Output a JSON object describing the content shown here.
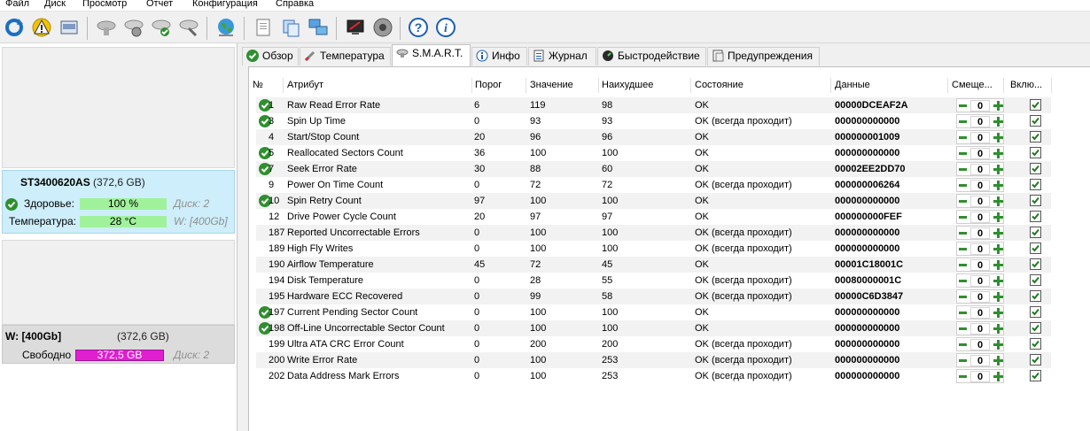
{
  "menu": [
    "Файл",
    "Диск",
    "Просмотр",
    "Отчет",
    "Конфигурация",
    "Справка"
  ],
  "toolbar": {
    "icons": [
      "refresh-icon",
      "warning-icon",
      "drive-icon",
      "disk-gray-icon",
      "disk-settings-icon",
      "disk-check-icon",
      "disk-tools-icon",
      "globe-icon",
      "document-icon",
      "copy-icon",
      "network-icon",
      "monitor-icon",
      "speaker-icon",
      "help-icon",
      "info-icon"
    ]
  },
  "left": {
    "disk": {
      "name": "ST3400620AS",
      "size": "(372,6 GB)",
      "health_label": "Здоровье:",
      "health_value": "100 %",
      "health_fill": 1.0,
      "disk_label": "Диск: 2",
      "temp_label": "Температура:",
      "temp_value": "28 °C",
      "temp_fill": 1.0,
      "volume_ref": "W: [400Gb]"
    },
    "volume": {
      "name": "W: [400Gb]",
      "size": "(372,6 GB)",
      "free_label": "Свободно",
      "free_value": "372,5 GB",
      "free_fill": 1.0,
      "disk_label": "Диск: 2"
    }
  },
  "tabs": [
    {
      "label": "Обзор",
      "icon": "overview-check-icon"
    },
    {
      "label": "Температура",
      "icon": "thermometer-icon"
    },
    {
      "label": "S.M.A.R.T.",
      "icon": "smart-disk-icon",
      "active": true
    },
    {
      "label": "Инфо",
      "icon": "info-icon"
    },
    {
      "label": "Журнал",
      "icon": "journal-icon"
    },
    {
      "label": "Быстродействие",
      "icon": "speedometer-icon"
    },
    {
      "label": "Предупреждения",
      "icon": "warnings-icon"
    }
  ],
  "table": {
    "headers": [
      "№",
      "Атрибут",
      "Порог",
      "Значение",
      "Наихудшее",
      "Состояние",
      "Данные",
      "Смеще...",
      "Вклю..."
    ],
    "rows": [
      {
        "ok": true,
        "id": "1",
        "name": "Raw Read Error Rate",
        "threshold": "6",
        "value": "119",
        "worst": "98",
        "status": "OK",
        "data": "00000DCEAF2A",
        "offset": "0",
        "enabled": true
      },
      {
        "ok": true,
        "id": "3",
        "name": "Spin Up Time",
        "threshold": "0",
        "value": "93",
        "worst": "93",
        "status": "OK (всегда проходит)",
        "data": "000000000000",
        "offset": "0",
        "enabled": true
      },
      {
        "ok": false,
        "id": "4",
        "name": "Start/Stop Count",
        "threshold": "20",
        "value": "96",
        "worst": "96",
        "status": "OK",
        "data": "000000001009",
        "offset": "0",
        "enabled": true
      },
      {
        "ok": true,
        "id": "5",
        "name": "Reallocated Sectors Count",
        "threshold": "36",
        "value": "100",
        "worst": "100",
        "status": "OK",
        "data": "000000000000",
        "offset": "0",
        "enabled": true
      },
      {
        "ok": true,
        "id": "7",
        "name": "Seek Error Rate",
        "threshold": "30",
        "value": "88",
        "worst": "60",
        "status": "OK",
        "data": "00002EE2DD70",
        "offset": "0",
        "enabled": true
      },
      {
        "ok": false,
        "id": "9",
        "name": "Power On Time Count",
        "threshold": "0",
        "value": "72",
        "worst": "72",
        "status": "OK (всегда проходит)",
        "data": "000000006264",
        "offset": "0",
        "enabled": true
      },
      {
        "ok": true,
        "id": "10",
        "name": "Spin Retry Count",
        "threshold": "97",
        "value": "100",
        "worst": "100",
        "status": "OK",
        "data": "000000000000",
        "offset": "0",
        "enabled": true
      },
      {
        "ok": false,
        "id": "12",
        "name": "Drive Power Cycle Count",
        "threshold": "20",
        "value": "97",
        "worst": "97",
        "status": "OK",
        "data": "000000000FEF",
        "offset": "0",
        "enabled": true
      },
      {
        "ok": false,
        "id": "187",
        "name": "Reported Uncorrectable Errors",
        "threshold": "0",
        "value": "100",
        "worst": "100",
        "status": "OK (всегда проходит)",
        "data": "000000000000",
        "offset": "0",
        "enabled": true
      },
      {
        "ok": false,
        "id": "189",
        "name": "High Fly Writes",
        "threshold": "0",
        "value": "100",
        "worst": "100",
        "status": "OK (всегда проходит)",
        "data": "000000000000",
        "offset": "0",
        "enabled": true
      },
      {
        "ok": false,
        "id": "190",
        "name": "Airflow Temperature",
        "threshold": "45",
        "value": "72",
        "worst": "45",
        "status": "OK",
        "data": "00001C18001C",
        "offset": "0",
        "enabled": true
      },
      {
        "ok": false,
        "id": "194",
        "name": "Disk Temperature",
        "threshold": "0",
        "value": "28",
        "worst": "55",
        "status": "OK (всегда проходит)",
        "data": "00080000001C",
        "offset": "0",
        "enabled": true
      },
      {
        "ok": false,
        "id": "195",
        "name": "Hardware ECC Recovered",
        "threshold": "0",
        "value": "99",
        "worst": "58",
        "status": "OK (всегда проходит)",
        "data": "00000C6D3847",
        "offset": "0",
        "enabled": true
      },
      {
        "ok": true,
        "id": "197",
        "name": "Current Pending Sector Count",
        "threshold": "0",
        "value": "100",
        "worst": "100",
        "status": "OK",
        "data": "000000000000",
        "offset": "0",
        "enabled": true
      },
      {
        "ok": true,
        "id": "198",
        "name": "Off-Line Uncorrectable Sector Count",
        "threshold": "0",
        "value": "100",
        "worst": "100",
        "status": "OK",
        "data": "000000000000",
        "offset": "0",
        "enabled": true
      },
      {
        "ok": false,
        "id": "199",
        "name": "Ultra ATA CRC Error Count",
        "threshold": "0",
        "value": "200",
        "worst": "200",
        "status": "OK (всегда проходит)",
        "data": "000000000000",
        "offset": "0",
        "enabled": true
      },
      {
        "ok": false,
        "id": "200",
        "name": "Write Error Rate",
        "threshold": "0",
        "value": "100",
        "worst": "253",
        "status": "OK (всегда проходит)",
        "data": "000000000000",
        "offset": "0",
        "enabled": true
      },
      {
        "ok": false,
        "id": "202",
        "name": "Data Address Mark Errors",
        "threshold": "0",
        "value": "100",
        "worst": "253",
        "status": "OK (всегда проходит)",
        "data": "000000000000",
        "offset": "0",
        "enabled": true
      }
    ]
  },
  "colors": {
    "ok_green": "#2f8f2f",
    "health_bar": "#9ff29a",
    "free_bar": "#e01fd0",
    "selected_card": "#cdeefa"
  }
}
